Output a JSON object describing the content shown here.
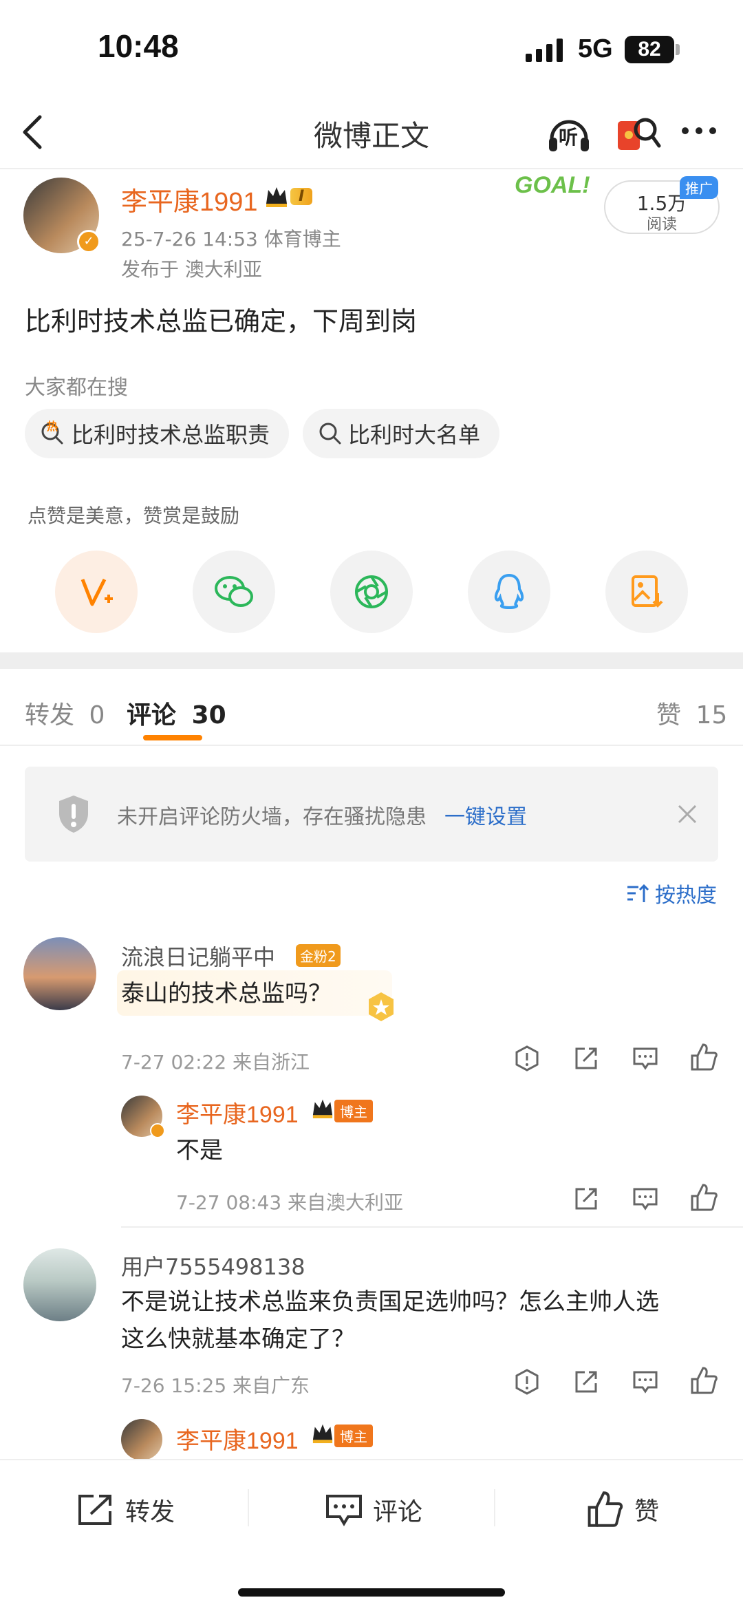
{
  "status": {
    "time": "10:48",
    "network": "5G",
    "battery": "82"
  },
  "nav": {
    "title": "微博正文",
    "listen_label": "听"
  },
  "post": {
    "author": "李平康1991",
    "level_badge": "I",
    "meta": "25-7-26 14:53  体育博主",
    "location": "发布于 澳大利亚",
    "goal_text": "GOAL!",
    "reads": "1.5万",
    "reads_label": "阅读",
    "promo_tag": "推广",
    "text": "比利时技术总监已确定，下周到岗",
    "search_heading": "大家都在搜",
    "searches": [
      "比利时技术总监职责",
      "比利时大名单"
    ],
    "hot_badge": "热",
    "reward_text": "点赞是美意，赞赏是鼓励"
  },
  "tabs": {
    "repost": "转发",
    "repost_count": "0",
    "comment": "评论",
    "comment_count": "30",
    "like": "赞",
    "like_count": "15"
  },
  "firewall": {
    "text": "未开启评论防火墙，存在骚扰隐患",
    "link": "一键设置"
  },
  "sort": {
    "label": "按热度"
  },
  "comments": [
    {
      "name": "流浪日记躺平中",
      "badge": "金粉2",
      "text": "泰山的技术总监吗？",
      "meta": "7-27 02:22  来自浙江",
      "reply": {
        "name": "李平康1991",
        "badge": "博主",
        "text": "不是",
        "meta": "7-27 08:43  来自澳大利亚"
      }
    },
    {
      "name": "用户7555498138",
      "text_line1": "不是说让技术总监来负责国足选帅吗？怎么主帅人选",
      "text_line2": "这么快就基本确定了？",
      "meta": "7-26 15:25  来自广东",
      "reply": {
        "name": "李平康1991",
        "badge": "博主"
      }
    }
  ],
  "bottom": {
    "repost": "转发",
    "comment": "评论",
    "like": "赞"
  },
  "colors": {
    "accent": "#e8661f",
    "link": "#2c6ec9",
    "highlight": "#ff8200"
  }
}
